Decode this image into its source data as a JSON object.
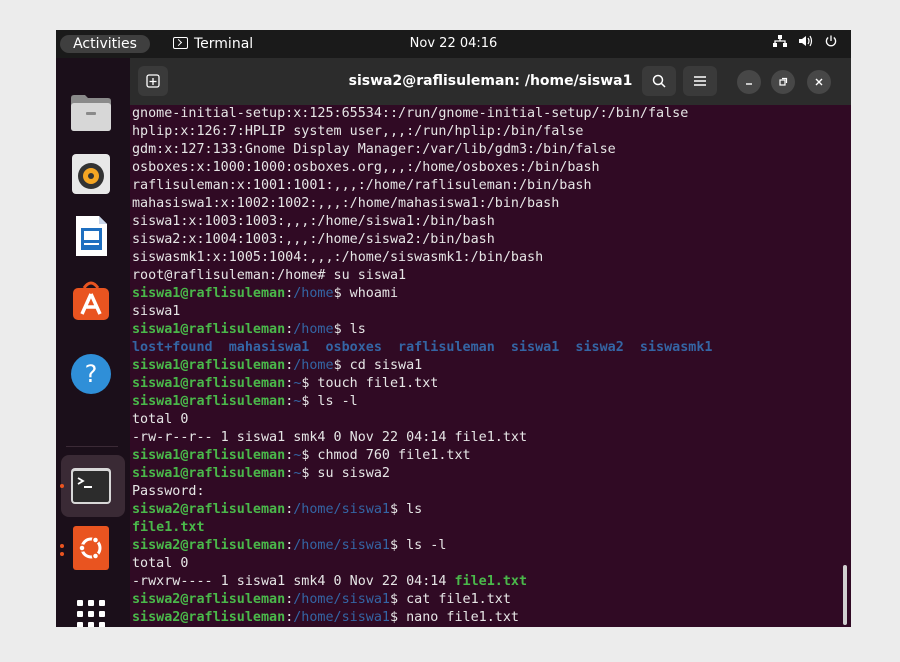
{
  "topbar": {
    "activities": "Activities",
    "app_name": "Terminal",
    "clock": "Nov 22  04:16"
  },
  "terminal": {
    "title": "siswa2@raflisuleman: /home/siswa1",
    "lines": [
      [
        {
          "t": "gnome-initial-setup:x:125:65534::/run/gnome-initial-setup/:/bin/false",
          "c": "w"
        }
      ],
      [
        {
          "t": "hplip:x:126:7:HPLIP system user,,,:/run/hplip:/bin/false",
          "c": "w"
        }
      ],
      [
        {
          "t": "gdm:x:127:133:Gnome Display Manager:/var/lib/gdm3:/bin/false",
          "c": "w"
        }
      ],
      [
        {
          "t": "osboxes:x:1000:1000:osboxes.org,,,:/home/osboxes:/bin/bash",
          "c": "w"
        }
      ],
      [
        {
          "t": "raflisuleman:x:1001:1001:,,,:/home/raflisuleman:/bin/bash",
          "c": "w"
        }
      ],
      [
        {
          "t": "mahasiswa1:x:1002:1002:,,,:/home/mahasiswa1:/bin/bash",
          "c": "w"
        }
      ],
      [
        {
          "t": "siswa1:x:1003:1003:,,,:/home/siswa1:/bin/bash",
          "c": "w"
        }
      ],
      [
        {
          "t": "siswa2:x:1004:1003:,,,:/home/siswa2:/bin/bash",
          "c": "w"
        }
      ],
      [
        {
          "t": "siswasmk1:x:1005:1004:,,,:/home/siswasmk1:/bin/bash",
          "c": "w"
        }
      ],
      [
        {
          "t": "root@raflisuleman:/home# su siswa1",
          "c": "w"
        }
      ],
      [
        {
          "t": "siswa1@raflisuleman",
          "c": "g"
        },
        {
          "t": ":",
          "c": "w"
        },
        {
          "t": "/home",
          "c": "b"
        },
        {
          "t": "$ whoami",
          "c": "w"
        }
      ],
      [
        {
          "t": "siswa1",
          "c": "w"
        }
      ],
      [
        {
          "t": "siswa1@raflisuleman",
          "c": "g"
        },
        {
          "t": ":",
          "c": "w"
        },
        {
          "t": "/home",
          "c": "b"
        },
        {
          "t": "$ ls",
          "c": "w"
        }
      ],
      [
        {
          "t": "lost+found  mahasiswa1  osboxes  raflisuleman  siswa1  siswa2  siswasmk1",
          "c": "bd"
        }
      ],
      [
        {
          "t": "siswa1@raflisuleman",
          "c": "g"
        },
        {
          "t": ":",
          "c": "w"
        },
        {
          "t": "/home",
          "c": "b"
        },
        {
          "t": "$ cd siswa1",
          "c": "w"
        }
      ],
      [
        {
          "t": "siswa1@raflisuleman",
          "c": "g"
        },
        {
          "t": ":",
          "c": "w"
        },
        {
          "t": "~",
          "c": "b"
        },
        {
          "t": "$ touch file1.txt",
          "c": "w"
        }
      ],
      [
        {
          "t": "siswa1@raflisuleman",
          "c": "g"
        },
        {
          "t": ":",
          "c": "w"
        },
        {
          "t": "~",
          "c": "b"
        },
        {
          "t": "$ ls -l",
          "c": "w"
        }
      ],
      [
        {
          "t": "total 0",
          "c": "w"
        }
      ],
      [
        {
          "t": "-rw-r--r-- 1 siswa1 smk4 0 Nov 22 04:14 file1.txt",
          "c": "w"
        }
      ],
      [
        {
          "t": "siswa1@raflisuleman",
          "c": "g"
        },
        {
          "t": ":",
          "c": "w"
        },
        {
          "t": "~",
          "c": "b"
        },
        {
          "t": "$ chmod 760 file1.txt",
          "c": "w"
        }
      ],
      [
        {
          "t": "siswa1@raflisuleman",
          "c": "g"
        },
        {
          "t": ":",
          "c": "w"
        },
        {
          "t": "~",
          "c": "b"
        },
        {
          "t": "$ su siswa2",
          "c": "w"
        }
      ],
      [
        {
          "t": "Password:",
          "c": "w"
        }
      ],
      [
        {
          "t": "siswa2@raflisuleman",
          "c": "g"
        },
        {
          "t": ":",
          "c": "w"
        },
        {
          "t": "/home/siswa1",
          "c": "b"
        },
        {
          "t": "$ ls",
          "c": "w"
        }
      ],
      [
        {
          "t": "file1.txt",
          "c": "gn"
        }
      ],
      [
        {
          "t": "siswa2@raflisuleman",
          "c": "g"
        },
        {
          "t": ":",
          "c": "w"
        },
        {
          "t": "/home/siswa1",
          "c": "b"
        },
        {
          "t": "$ ls -l",
          "c": "w"
        }
      ],
      [
        {
          "t": "total 0",
          "c": "w"
        }
      ],
      [
        {
          "t": "-rwxrw---- 1 siswa1 smk4 0 Nov 22 04:14 ",
          "c": "w"
        },
        {
          "t": "file1.txt",
          "c": "gn"
        }
      ],
      [
        {
          "t": "siswa2@raflisuleman",
          "c": "g"
        },
        {
          "t": ":",
          "c": "w"
        },
        {
          "t": "/home/siswa1",
          "c": "b"
        },
        {
          "t": "$ cat file1.txt",
          "c": "w"
        }
      ],
      [
        {
          "t": "siswa2@raflisuleman",
          "c": "g"
        },
        {
          "t": ":",
          "c": "w"
        },
        {
          "t": "/home/siswa1",
          "c": "b"
        },
        {
          "t": "$ nano file1.txt",
          "c": "w"
        }
      ]
    ]
  },
  "dock": {
    "items": [
      "files-icon",
      "rhythmbox-icon",
      "writer-icon",
      "app-center-icon",
      "help-icon",
      "terminal-icon",
      "ubuntu-icon",
      "show-apps-icon"
    ]
  },
  "colors": {
    "terminal_bg": "#300a24",
    "prompt_green": "#4ab84a",
    "path_blue": "#3465a4",
    "accent_orange": "#e95420"
  }
}
